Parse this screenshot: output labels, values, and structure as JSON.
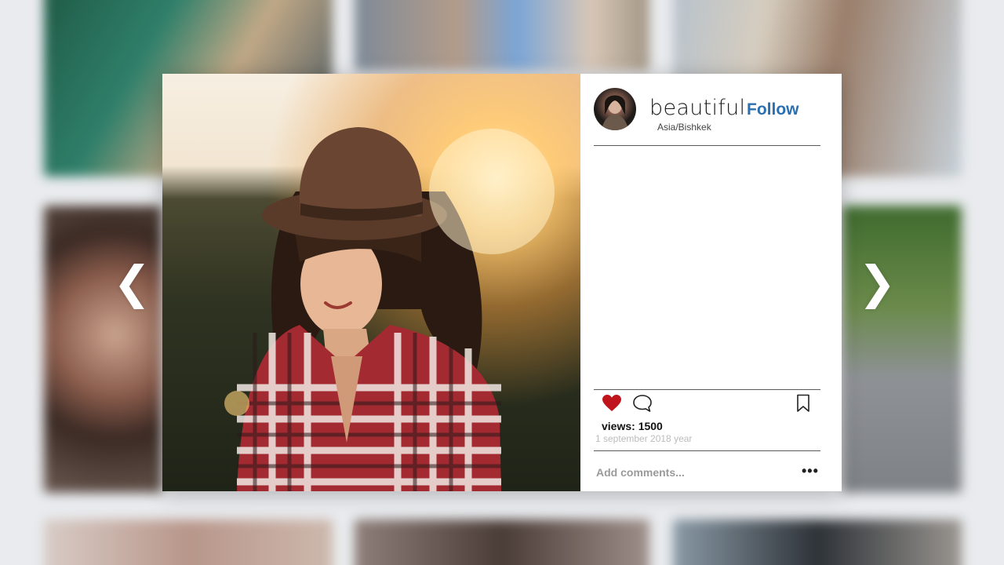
{
  "post": {
    "username": "beautiful",
    "follow_label": "Follow",
    "location": "Asia/Bishkek",
    "views_label": "views: 1500",
    "date": "1 september 2018 year",
    "comment_placeholder": "Add comments...",
    "more_label": "•••"
  },
  "nav": {
    "prev_glyph": "❮",
    "next_glyph": "❯"
  },
  "icons": {
    "heart": "heart-icon",
    "comment": "comment-icon",
    "bookmark": "bookmark-icon",
    "more": "more-options-icon"
  },
  "colors": {
    "accent": "#2a6fb0",
    "heart": "#c0141c",
    "background": "#e9ebee"
  }
}
